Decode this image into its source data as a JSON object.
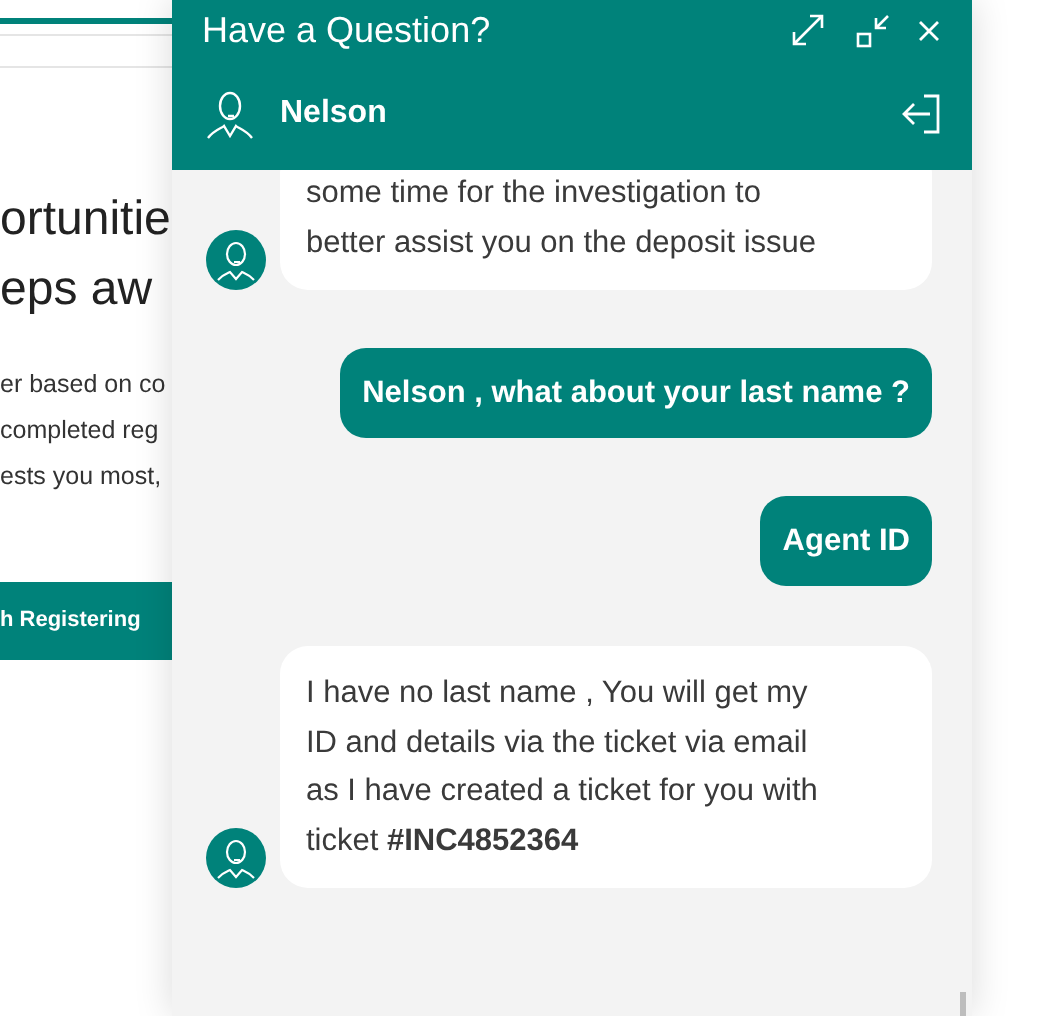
{
  "background_page": {
    "heading_lines": [
      "ortunitie",
      "eps aw"
    ],
    "body_lines": [
      "er based on co",
      "completed reg",
      "ests you most,"
    ],
    "button": "h Registering"
  },
  "chat": {
    "title": "Have a Question?",
    "agent_name": "Nelson",
    "messages": [
      {
        "kind": "agent",
        "lines": [
          "some time for the investigation to",
          "better assist you on the deposit issue"
        ],
        "avatar": true
      },
      {
        "kind": "user",
        "lines": [
          "Nelson , what about your last name ?"
        ]
      },
      {
        "kind": "user",
        "lines": [
          "Agent ID"
        ]
      },
      {
        "kind": "agent",
        "lines": [
          "I have no last name , You will get my",
          "ID and details via the ticket via email",
          "as I have created a ticket for you with",
          "ticket **#INC4852364**"
        ],
        "avatar": true
      }
    ]
  }
}
